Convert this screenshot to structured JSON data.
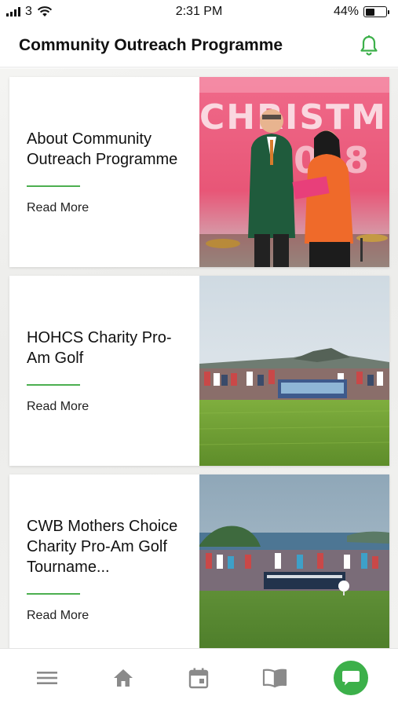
{
  "status_bar": {
    "carrier": "3",
    "time": "2:31 PM",
    "battery": "44%",
    "battery_level": 0.44
  },
  "header": {
    "title": "Community Outreach Programme",
    "bell_icon": "bell-icon"
  },
  "colors": {
    "accent": "#4caf50",
    "chat_button": "#3cb04a"
  },
  "cards": [
    {
      "title": "About Community Outreach Programme",
      "read_more": "Read More"
    },
    {
      "title": "HOHCS Charity Pro-Am Golf",
      "read_more": "Read More"
    },
    {
      "title": "CWB Mothers Choice Charity Pro-Am Golf Tourname...",
      "read_more": "Read More"
    }
  ],
  "bottom_nav": [
    "menu-icon",
    "home-icon",
    "calendar-icon",
    "book-icon",
    "chat-icon"
  ]
}
